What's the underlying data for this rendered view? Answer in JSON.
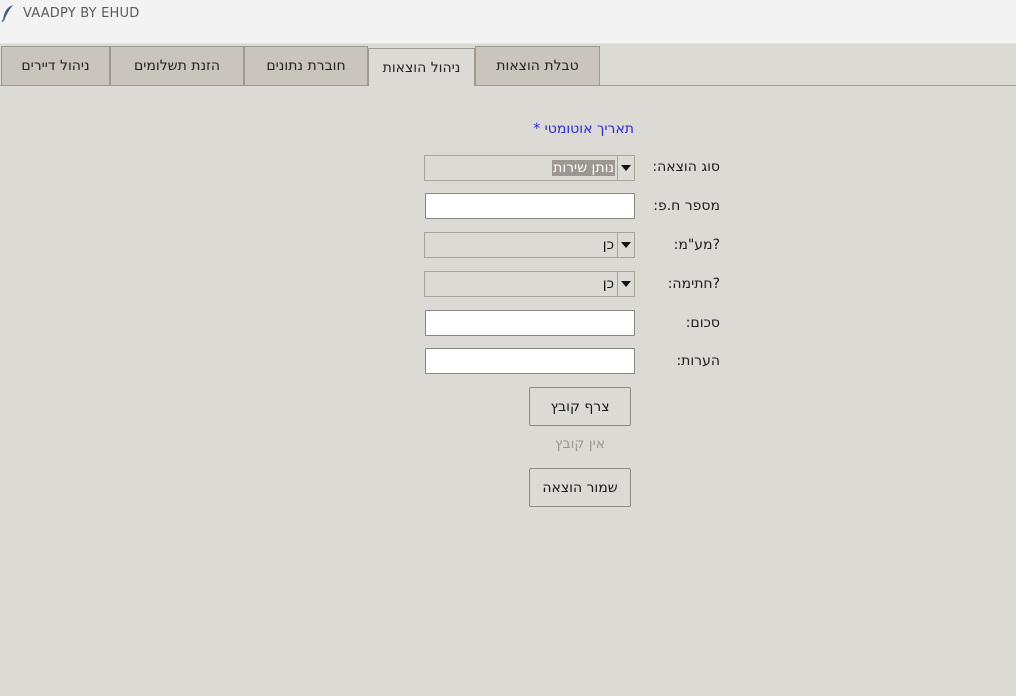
{
  "window": {
    "title": "VAADPY BY EHUD",
    "icon": "feather-icon"
  },
  "tabs": [
    {
      "label": "ניהול דיירים",
      "selected": false
    },
    {
      "label": "הזנת תשלומים",
      "selected": false
    },
    {
      "label": "חוברת נתונים",
      "selected": false
    },
    {
      "label": "ניהול הוצאות",
      "selected": true
    },
    {
      "label": "טבלת הוצאות",
      "selected": false
    }
  ],
  "form": {
    "auto_date_note": "תאריך אוטומטי *",
    "expense_type": {
      "label": "סוג הוצאה:",
      "value": "נותן שירות"
    },
    "receipt_number": {
      "label": "מספר ח.פ:",
      "value": ""
    },
    "vat": {
      "label": "?מע\"מ:",
      "value": "כן"
    },
    "signature": {
      "label": "?חתימה:",
      "value": "כן"
    },
    "amount": {
      "label": "סכום:",
      "value": ""
    },
    "notes": {
      "label": "הערות:",
      "value": ""
    },
    "attach_file_button": "צרף קובץ",
    "no_file_text": "אין קובץ",
    "save_button": "שמור הוצאה"
  },
  "colors": {
    "background": "#dcdad5",
    "auto_note": "#2b2bd8",
    "tab_inactive": "#c9c5bc"
  }
}
